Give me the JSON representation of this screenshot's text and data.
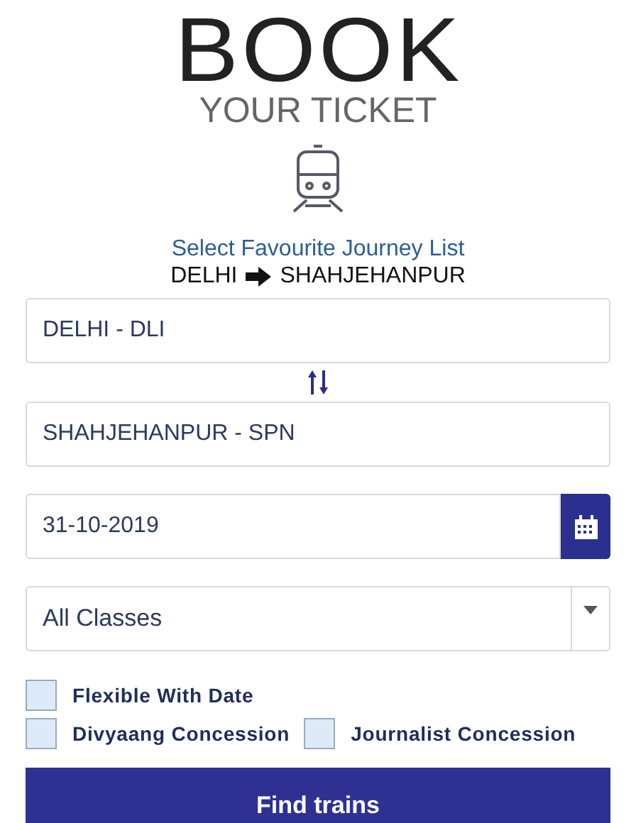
{
  "logo": {
    "title": "BOOK",
    "subtitle": "YOUR TICKET"
  },
  "favourite_link": "Select Favourite Journey List",
  "route": {
    "from": "DELHI",
    "to": "SHAHJEHANPUR"
  },
  "from_station": {
    "value": "DELHI - DLI"
  },
  "to_station": {
    "value": "SHAHJEHANPUR - SPN"
  },
  "date": {
    "value": "31-10-2019"
  },
  "class_select": {
    "value": "All Classes"
  },
  "options": [
    {
      "label": "Flexible With Date",
      "checked": false
    },
    {
      "label": "Divyaang Concession",
      "checked": false
    },
    {
      "label": "Journalist Concession",
      "checked": false
    }
  ],
  "submit": "Find trains"
}
